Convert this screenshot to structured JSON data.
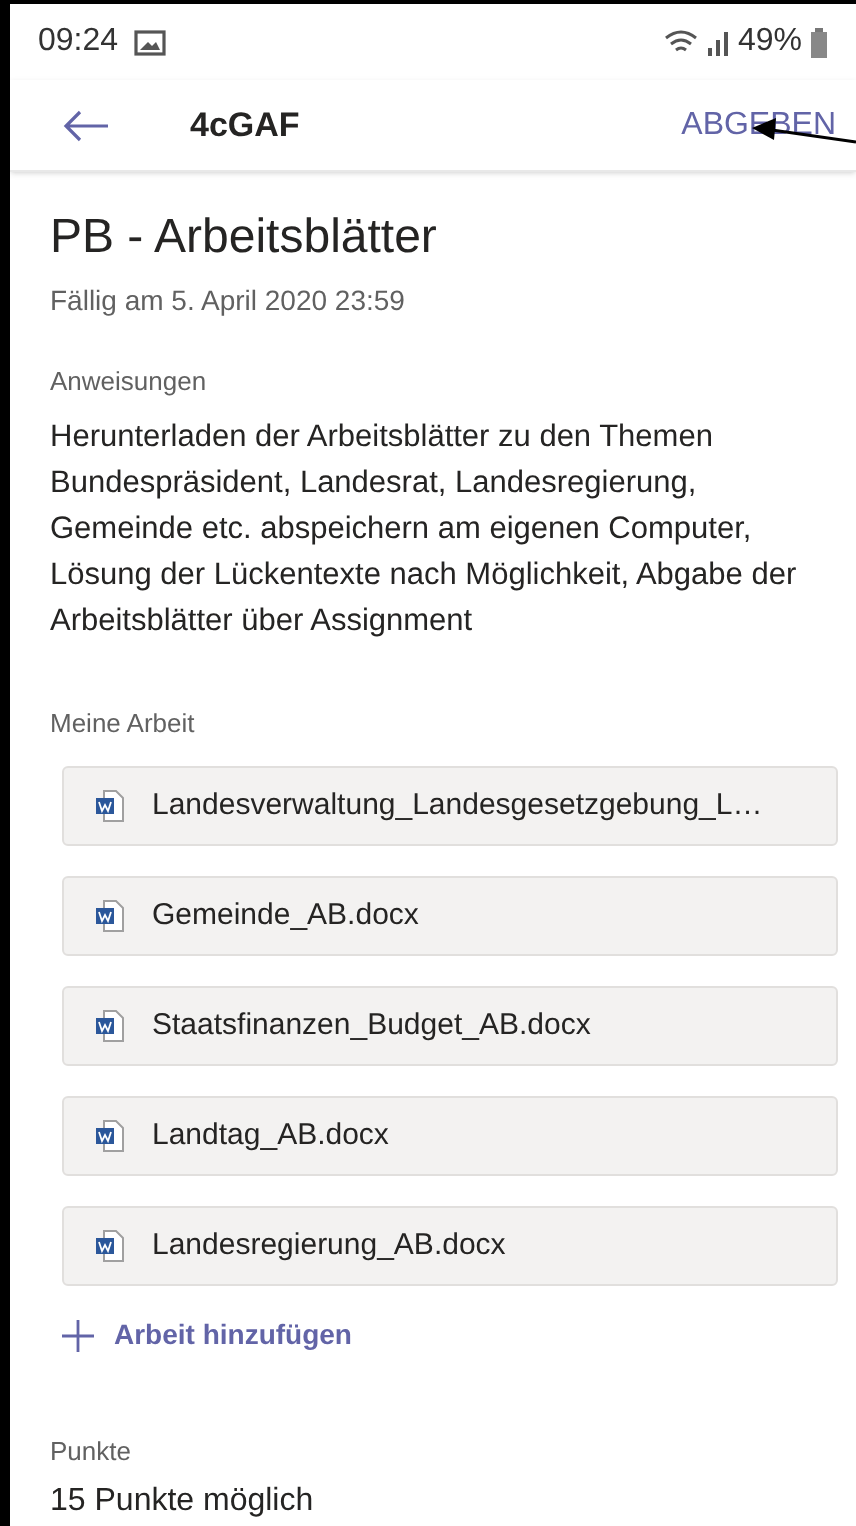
{
  "status_bar": {
    "time": "09:24",
    "battery": "49%"
  },
  "header": {
    "title": "4cGAF",
    "action": "ABGEBEN"
  },
  "assignment": {
    "title": "PB - Arbeitsblätter",
    "due": "Fällig am 5. April 2020 23:59"
  },
  "instructions": {
    "label": "Anweisungen",
    "text": "Herunterladen der Arbeitsblätter zu den Themen Bundespräsident, Landesrat, Landesregierung, Gemeinde etc. abspeichern am eigenen Computer, Lösung der Lückentexte nach Möglichkeit, Abgabe der Arbeitsblätter über Assignment"
  },
  "my_work": {
    "label": "Meine Arbeit",
    "files": [
      {
        "name": "Landesverwaltung_Landesgesetzgebung_L…"
      },
      {
        "name": "Gemeinde_AB.docx"
      },
      {
        "name": "Staatsfinanzen_Budget_AB.docx"
      },
      {
        "name": "Landtag_AB.docx"
      },
      {
        "name": "Landesregierung_AB.docx"
      }
    ],
    "add_link": "Arbeit hinzufügen"
  },
  "points": {
    "label": "Punkte",
    "value": "15 Punkte möglich"
  }
}
